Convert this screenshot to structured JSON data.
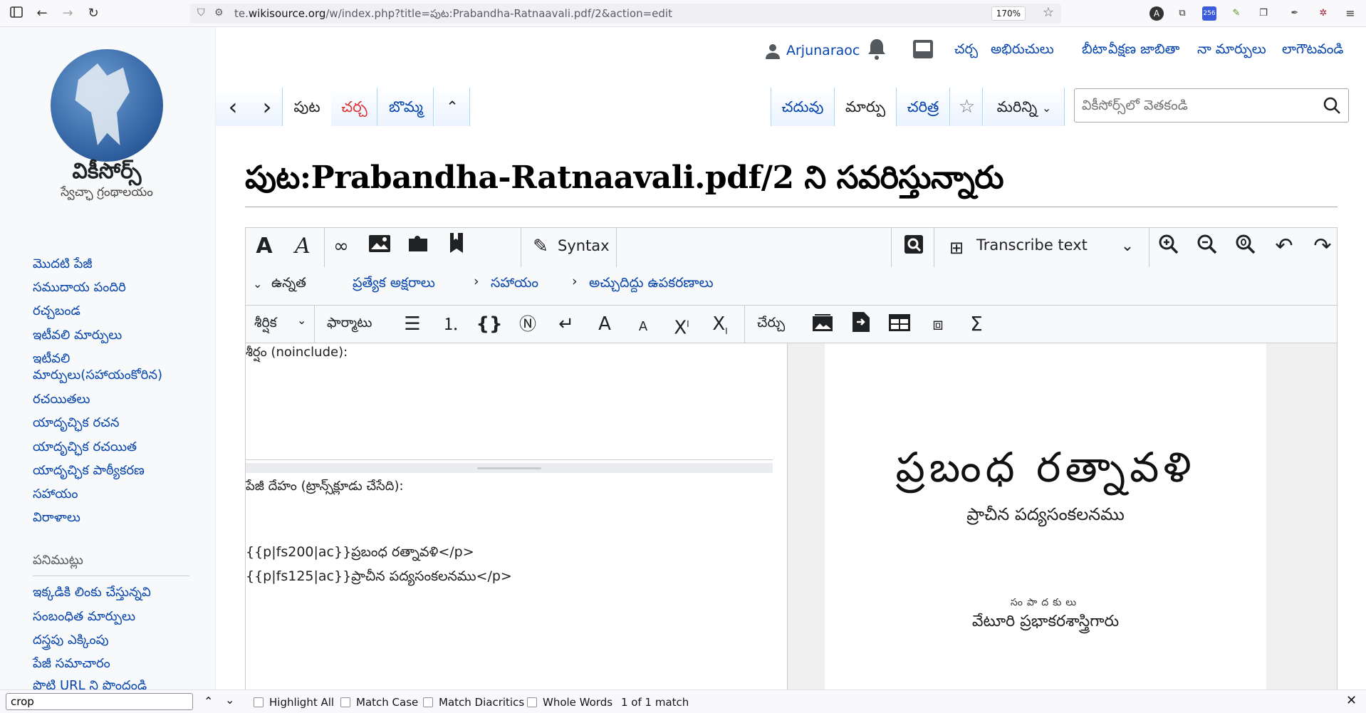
{
  "browser": {
    "url_prefix": "te.",
    "url_domain": "wikisource.org",
    "url_path": "/w/index.php?title=పుట:Prabandha-Ratnaavali.pdf/2&action=edit",
    "zoom": "170%"
  },
  "sidebar": {
    "logo_text": "వికీసోర్స్",
    "logo_tagline": "స్వేచ్ఛా గ్రంథాలయం",
    "nav": [
      "మొదటి పేజీ",
      "సముదాయ పందిరి",
      "రచ్చబండ",
      "ఇటీవలి మార్పులు",
      "ఇటీవలి",
      "మార్పులు(సహాయంకోరిన)",
      "రచయితలు",
      "యాదృచ్ఛిక రచన",
      "యాదృచ్ఛిక రచయిత",
      "యాదృచ్ఛిక పాఠ్యీకరణ",
      "సహాయం",
      "విరాళాలు"
    ],
    "tools_heading": "పనిముట్లు",
    "tools": [
      "ఇక్కడికి లింకు చేస్తున్నవి",
      "సంబంధిత మార్పులు",
      "దస్త్రపు ఎక్కింపు",
      "పేజీ సమాచారం",
      "పొట్టి URL ని పొందండి"
    ]
  },
  "user_bar": {
    "username": "Arjunaraoc",
    "links": [
      "చర్చ",
      "అభిరుచులు",
      "బీటా",
      "వీక్షణ జాబితా",
      "నా మార్పులు",
      "లాగౌటవండి"
    ]
  },
  "tabs": {
    "left": [
      "పుట",
      "చర్చ",
      "బొమ్మ"
    ],
    "right": [
      "చదువు",
      "మార్పు",
      "చరిత్ర"
    ],
    "more": "మరిన్ని"
  },
  "search": {
    "placeholder": "వికీసోర్స్‌లో వెతకండి"
  },
  "page": {
    "title": "పుట:Prabandha-Ratnaavali.pdf/2 ని సవరిస్తున్నారు"
  },
  "editor": {
    "syntax_label": "Syntax",
    "transcribe_label": "Transcribe text",
    "advanced_label": "ఉన్నత",
    "special_chars_label": "ప్రత్యేక అక్షరాలు",
    "help_label": "సహాయం",
    "proofread_tools_label": "అచ్చుదిద్దు ఉపకరణాలు",
    "heading_label": "శీర్షిక",
    "format_label": "ఫార్మాటు",
    "insert_label": "చేర్చు",
    "header_field_label": "శీర్షం (noinclude):",
    "body_field_label": "పేజీ దేహం (ట్రాన్స్‌క్లూడు చేసేది):",
    "body_lines": [
      "{{p|fs200|ac}}ప్రబంధ రత్నావళి</p>",
      "{{p|fs125|ac}}ప్రాచీన పద్యసంకలనము</p>"
    ]
  },
  "scan": {
    "title": "ప్రబంధ రత్నావళి",
    "subtitle": "ప్రాచీన పద్యసంకలనము",
    "editor_caption": "సంపాదకులు",
    "author": "వేటూరి ప్రభాకరశాస్త్రిగారు"
  },
  "findbar": {
    "query": "crop",
    "highlight_all": "Highlight All",
    "match_case": "Match Case",
    "match_diacritics": "Match Diacritics",
    "whole_words": "Whole Words",
    "result": "1 of 1 match"
  }
}
